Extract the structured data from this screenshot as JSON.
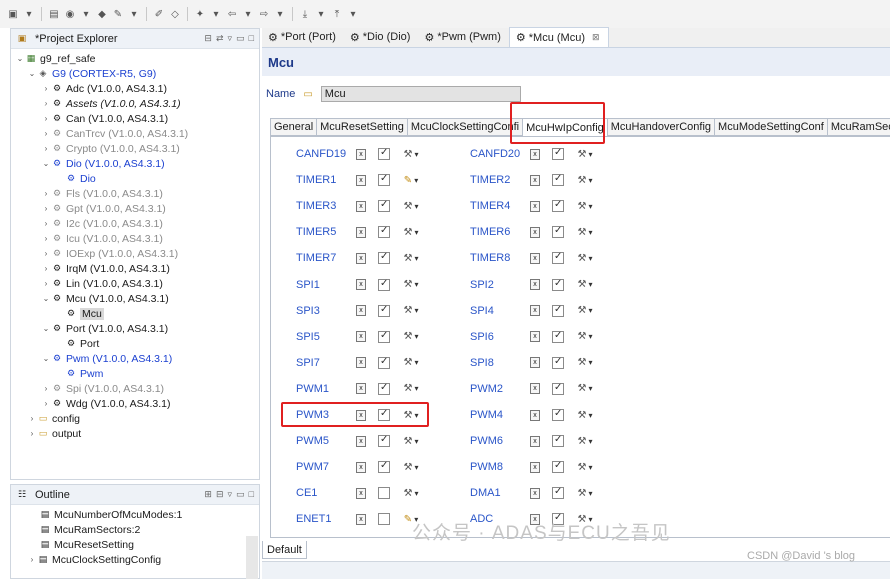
{
  "project_explorer": {
    "title": "*Project Explorer",
    "items": [
      {
        "label": "g9_ref_safe"
      },
      {
        "label": "G9 (CORTEX-R5, G9)"
      },
      {
        "label": "Adc (V1.0.0, AS4.3.1)"
      },
      {
        "label": "Assets (V1.0.0, AS4.3.1)"
      },
      {
        "label": "Can (V1.0.0, AS4.3.1)"
      },
      {
        "label": "CanTrcv (V1.0.0, AS4.3.1)"
      },
      {
        "label": "Crypto (V1.0.0, AS4.3.1)"
      },
      {
        "label": "Dio (V1.0.0, AS4.3.1)"
      },
      {
        "label": "Dio"
      },
      {
        "label": "Fls (V1.0.0, AS4.3.1)"
      },
      {
        "label": "Gpt (V1.0.0, AS4.3.1)"
      },
      {
        "label": "I2c (V1.0.0, AS4.3.1)"
      },
      {
        "label": "Icu (V1.0.0, AS4.3.1)"
      },
      {
        "label": "IOExp (V1.0.0, AS4.3.1)"
      },
      {
        "label": "IrqM (V1.0.0, AS4.3.1)"
      },
      {
        "label": "Lin (V1.0.0, AS4.3.1)"
      },
      {
        "label": "Mcu (V1.0.0, AS4.3.1)"
      },
      {
        "label": "Mcu"
      },
      {
        "label": "Port (V1.0.0, AS4.3.1)"
      },
      {
        "label": "Port"
      },
      {
        "label": "Pwm (V1.0.0, AS4.3.1)"
      },
      {
        "label": "Pwm"
      },
      {
        "label": "Spi (V1.0.0, AS4.3.1)"
      },
      {
        "label": "Wdg (V1.0.0, AS4.3.1)"
      },
      {
        "label": "config"
      },
      {
        "label": "output"
      }
    ]
  },
  "outline": {
    "title": "Outline",
    "items": [
      {
        "label": "McuNumberOfMcuModes:1"
      },
      {
        "label": "McuRamSectors:2"
      },
      {
        "label": "McuResetSetting"
      },
      {
        "label": "McuClockSettingConfig"
      }
    ]
  },
  "editor": {
    "tabs": [
      {
        "label": "*Port (Port)"
      },
      {
        "label": "*Dio (Dio)"
      },
      {
        "label": "*Pwm (Pwm)"
      },
      {
        "label": "*Mcu (Mcu)"
      }
    ],
    "title": "Mcu",
    "name_label": "Name",
    "name_value": "Mcu",
    "subtabs": [
      {
        "label": "General"
      },
      {
        "label": "McuResetSetting"
      },
      {
        "label": "McuClockSettingConfi"
      },
      {
        "label": "McuHwIpConfig"
      },
      {
        "label": "McuHandoverConfig"
      },
      {
        "label": "McuModeSettingConf"
      },
      {
        "label": "McuRamSec"
      }
    ],
    "active_subtab": "McuHwIpConfig",
    "left_column": [
      {
        "label": "CANFD19",
        "checked": true,
        "tool": "wrench"
      },
      {
        "label": "TIMER1",
        "checked": true,
        "tool": "pencil"
      },
      {
        "label": "TIMER3",
        "checked": true,
        "tool": "wrench"
      },
      {
        "label": "TIMER5",
        "checked": true,
        "tool": "wrench"
      },
      {
        "label": "TIMER7",
        "checked": true,
        "tool": "wrench"
      },
      {
        "label": "SPI1",
        "checked": true,
        "tool": "wrench"
      },
      {
        "label": "SPI3",
        "checked": true,
        "tool": "wrench"
      },
      {
        "label": "SPI5",
        "checked": true,
        "tool": "wrench"
      },
      {
        "label": "SPI7",
        "checked": true,
        "tool": "wrench"
      },
      {
        "label": "PWM1",
        "checked": true,
        "tool": "wrench"
      },
      {
        "label": "PWM3",
        "checked": true,
        "tool": "wrench"
      },
      {
        "label": "PWM5",
        "checked": true,
        "tool": "wrench"
      },
      {
        "label": "PWM7",
        "checked": true,
        "tool": "wrench"
      },
      {
        "label": "CE1",
        "checked": false,
        "tool": "wrench"
      },
      {
        "label": "ENET1",
        "checked": false,
        "tool": "pencil"
      }
    ],
    "right_column": [
      {
        "label": "CANFD20",
        "checked": true
      },
      {
        "label": "TIMER2",
        "checked": true
      },
      {
        "label": "TIMER4",
        "checked": true
      },
      {
        "label": "TIMER6",
        "checked": true
      },
      {
        "label": "TIMER8",
        "checked": true
      },
      {
        "label": "SPI2",
        "checked": true
      },
      {
        "label": "SPI4",
        "checked": true
      },
      {
        "label": "SPI6",
        "checked": true
      },
      {
        "label": "SPI8",
        "checked": true
      },
      {
        "label": "PWM2",
        "checked": true
      },
      {
        "label": "PWM4",
        "checked": true
      },
      {
        "label": "PWM6",
        "checked": true
      },
      {
        "label": "PWM8",
        "checked": true
      },
      {
        "label": "DMA1",
        "checked": true
      },
      {
        "label": "ADC",
        "checked": true
      }
    ],
    "default_tab": "Default"
  },
  "watermark": "公众号 · ADAS与ECU之吾见",
  "credit": "CSDN @David 's blog",
  "colors": {
    "highlight_border": "#e02020",
    "label_blue": "#2a55c8"
  }
}
